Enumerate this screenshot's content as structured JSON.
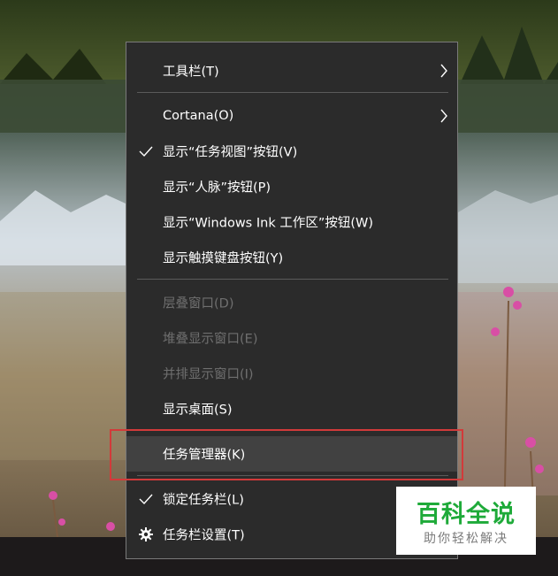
{
  "menu": {
    "toolbars": "工具栏(T)",
    "cortana": "Cortana(O)",
    "show_task_view": "显示“任务视图”按钮(V)",
    "show_people": "显示“人脉”按钮(P)",
    "show_windows_ink": "显示“Windows Ink 工作区”按钮(W)",
    "show_touch_keyboard": "显示触摸键盘按钮(Y)",
    "cascade_windows": "层叠窗口(D)",
    "stack_windows": "堆叠显示窗口(E)",
    "side_by_side": "并排显示窗口(I)",
    "show_desktop": "显示桌面(S)",
    "task_manager": "任务管理器(K)",
    "lock_taskbar": "锁定任务栏(L)",
    "taskbar_settings": "任务栏设置(T)"
  },
  "watermark": {
    "title": "百科全说",
    "subtitle": "助你轻松解决"
  },
  "colors": {
    "menu_bg": "#2b2b2b",
    "highlight": "#414141",
    "disabled_text": "#6f6f6f",
    "red_box": "#d23a3a",
    "watermark_green": "#1eaa39"
  }
}
